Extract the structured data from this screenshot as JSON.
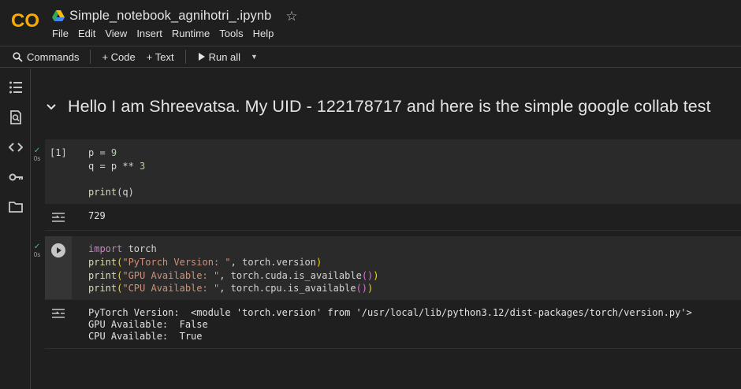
{
  "app": {
    "logo_text": "CO",
    "notebook_title": "Simple_notebook_agnihotri_.ipynb",
    "menu": [
      "File",
      "Edit",
      "View",
      "Insert",
      "Runtime",
      "Tools",
      "Help"
    ]
  },
  "toolbar": {
    "commands_label": "Commands",
    "code_label": "+ Code",
    "text_label": "+ Text",
    "run_all_label": "Run all"
  },
  "sidebar_icons": [
    "table-of-contents-icon",
    "find-icon",
    "code-snippets-icon",
    "secrets-key-icon",
    "files-folder-icon"
  ],
  "section": {
    "heading": "Hello I am Shreevatsa. My UID - 122178717 and here is the simple google collab test"
  },
  "cells": [
    {
      "exec_count": "[1]",
      "exec_time": "0s",
      "code_lines": [
        "p = 9",
        "q = p ** 3",
        "",
        "print(q)"
      ],
      "output_lines": [
        "729"
      ]
    },
    {
      "exec_count": "",
      "exec_time": "0s",
      "code_lines": [
        "import torch",
        "print(\"PyTorch Version: \", torch.version)",
        "print(\"GPU Available: \", torch.cuda.is_available())",
        "print(\"CPU Available: \", torch.cpu.is_available())"
      ],
      "output_lines": [
        "PyTorch Version:  <module 'torch.version' from '/usr/local/lib/python3.12/dist-packages/torch/version.py'>",
        "GPU Available:  False",
        "CPU Available:  True"
      ]
    }
  ],
  "colors": {
    "background": "#1f1f1f",
    "cell_background": "#2a2a2a",
    "logo_orange": "#f9ab00",
    "check_green": "#5bb974"
  }
}
